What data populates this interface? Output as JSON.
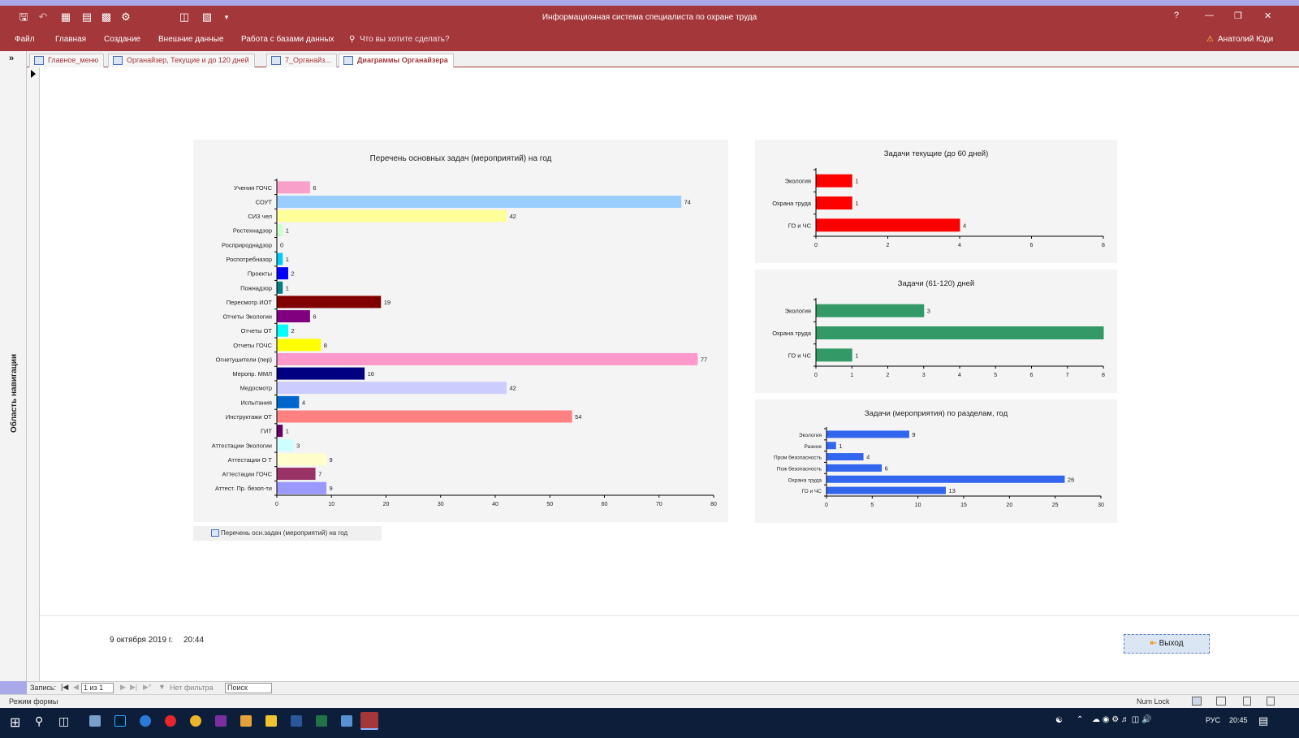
{
  "titlebar": {
    "title": "Информационная система специалиста по охране труда",
    "help": "?"
  },
  "ribbon": {
    "tabs": [
      "Файл",
      "Главная",
      "Создание",
      "Внешние данные",
      "Работа с базами данных"
    ],
    "tell_me": "Что вы хотите сделать?",
    "user": "Анатолий Юди"
  },
  "nav": {
    "collapse": "»",
    "label": "Область навигации"
  },
  "doc_tabs": [
    "Главное_меню",
    "Органайзер, Текущие и до 120 дней",
    "7_Органайз...",
    "Диаграммы Органайзера"
  ],
  "footer": {
    "date": "9 октября 2019 г.",
    "time": "20:44",
    "exit_label": "Выход",
    "report_link": "Перечень осн.задач (мероприятий) на год"
  },
  "record_bar": {
    "label": "Запись:",
    "position": "1 из 1",
    "filter": "Нет фильтра",
    "search": "Поиск"
  },
  "status": {
    "mode": "Режим формы",
    "numlock": "Num Lock"
  },
  "taskbar": {
    "lang": "РУС",
    "clock": "20:45"
  },
  "colors": {
    "accent": "#a4373a"
  },
  "chart_data": [
    {
      "type": "bar",
      "orientation": "horizontal",
      "title": "Перечень основных задач (мероприятий) на год",
      "categories": [
        "Учения ГОЧС",
        "СОУТ",
        "СИЗ чел",
        "Ростехнадзор",
        "Росприроднадзор",
        "Роспотребназор",
        "Проекты",
        "Пожнадзор",
        "Пересмотр ИОТ",
        "Отчеты Экологии",
        "Отчеты ОТ",
        "Отчеты ГОЧС",
        "Огнетушители (пер)",
        "Меропр. ММЛ",
        "Медосмотр",
        "Испытания",
        "Инструктажи ОТ",
        "ГИТ",
        "Аттестации Экологии",
        "Аттестации О Т",
        "Аттестации ГОЧС",
        "Аттест. Пр. безоп-ти"
      ],
      "values": [
        6,
        74,
        42,
        1,
        0,
        1,
        2,
        1,
        19,
        6,
        2,
        8,
        77,
        16,
        42,
        4,
        54,
        1,
        3,
        9,
        7,
        9
      ],
      "bar_colors": [
        "#f7a1c8",
        "#99ccff",
        "#ffff99",
        "#ccffcc",
        "#cccccc",
        "#00ccff",
        "#0000ff",
        "#008080",
        "#800000",
        "#800080",
        "#00ffff",
        "#ffff00",
        "#ff99cc",
        "#000080",
        "#ccccff",
        "#0066cc",
        "#ff8080",
        "#660066",
        "#ccffff",
        "#ffffcc",
        "#993366",
        "#9999ff"
      ],
      "xlim": [
        0,
        80
      ],
      "xticks": [
        0,
        10,
        20,
        30,
        40,
        50,
        60,
        70,
        80
      ]
    },
    {
      "type": "bar",
      "orientation": "horizontal",
      "title": "Задачи текущие (до 60 дней)",
      "categories": [
        "Экология",
        "Охрана труда",
        "ГО и ЧС"
      ],
      "values": [
        1,
        1,
        4
      ],
      "color": "#ff0000",
      "xlim": [
        0,
        8
      ],
      "xticks": [
        0,
        2,
        4,
        6,
        8
      ]
    },
    {
      "type": "bar",
      "orientation": "horizontal",
      "title": "Задачи (61-120) дней",
      "categories": [
        "Экология",
        "Охрана труда",
        "ГО и ЧС"
      ],
      "values": [
        3,
        8,
        1
      ],
      "value_labels": [
        "3",
        "",
        "1"
      ],
      "color": "#339966",
      "xlim": [
        0,
        8
      ],
      "xticks": [
        0,
        1,
        2,
        3,
        4,
        5,
        6,
        7,
        8
      ]
    },
    {
      "type": "bar",
      "orientation": "horizontal",
      "title": "Задачи (мероприятия) по разделам, год",
      "categories": [
        "Экология",
        "Разное",
        "Пром безопасность",
        "Пож безопасность",
        "Охрана труда",
        "ГО и ЧС"
      ],
      "values": [
        9,
        1,
        4,
        6,
        26,
        13
      ],
      "color": "#3366ee",
      "xlim": [
        0,
        30
      ],
      "xticks": [
        0,
        5,
        10,
        15,
        20,
        25,
        30
      ]
    }
  ]
}
